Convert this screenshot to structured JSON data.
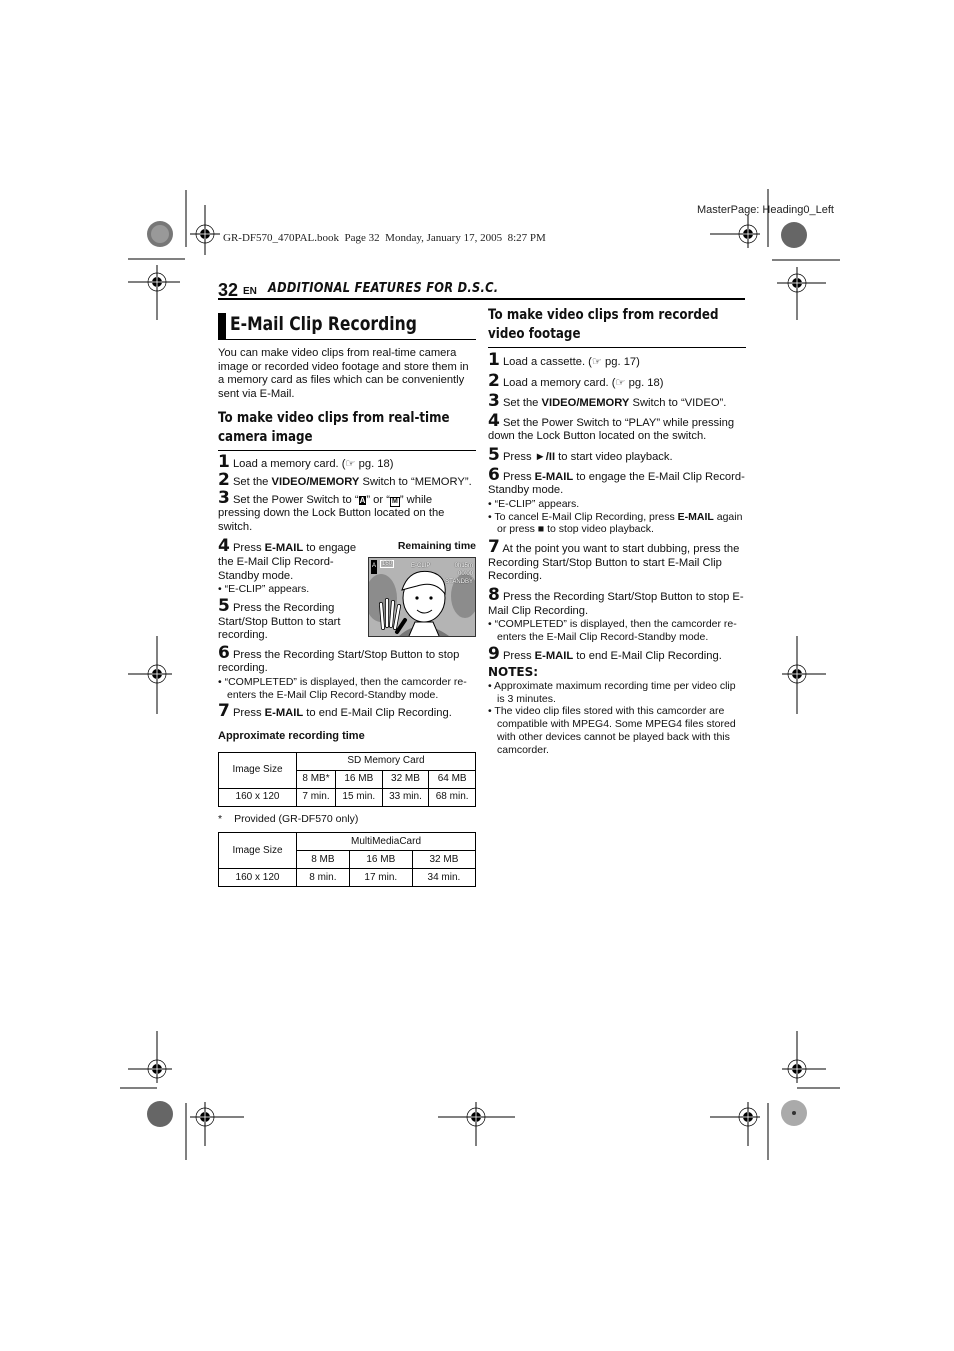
{
  "print_meta": {
    "book_line": "GR-DF570_470PAL.book  Page 32  Monday, January 17, 2005  8:27 PM",
    "master_page": "MasterPage: Heading0_Left"
  },
  "header": {
    "page_number": "32",
    "lang": "EN",
    "section": "ADDITIONAL FEATURES FOR D.S.C."
  },
  "left": {
    "title": "E-Mail Clip Recording",
    "intro": "You can make video clips from real-time camera image or recorded video footage and store them in a memory card as files which can be conveniently sent via E-Mail.",
    "subheading": "To make video clips from real-time camera image",
    "steps": [
      {
        "n": "1",
        "pre": "Load a memory card. (",
        "ref": "☞",
        "post": " pg. 18)"
      },
      {
        "n": "2",
        "pre": "Set the ",
        "bold": "VIDEO/MEMORY",
        "post": " Switch to “MEMORY”."
      },
      {
        "n": "3",
        "pre": "Set the Power Switch to “",
        "icon1": "A",
        "mid": "” or “",
        "icon2": "M",
        "post": "” while pressing down the Lock Button located on the switch."
      },
      {
        "n": "4",
        "pre": "Press ",
        "bold": "E-MAIL",
        "post": " to engage the E-Mail Clip Record-Standby mode."
      },
      {
        "n": "5",
        "pre": "Press the Recording Start/Stop Button to start recording."
      },
      {
        "n": "6",
        "pre": "Press the Recording Start/Stop Button to stop recording."
      },
      {
        "n": "7",
        "pre": "Press ",
        "bold": "E-MAIL",
        "post": " to end E-Mail Clip Recording."
      }
    ],
    "step4_bullet": "“E-CLIP” appears.",
    "step6_bullet": "“COMPLETED” is displayed, then the camcorder re-enters the E-Mail Clip Record-Standby mode.",
    "figure": {
      "label": "Remaining time",
      "osd_mode": "A",
      "osd_size": "160",
      "osd_eclip": "E-CLIP",
      "osd_remaining": "0h15m",
      "osd_counter": "00:00",
      "osd_status": "STANDBY"
    },
    "table_title": "Approximate recording time",
    "table1": {
      "row_header": "Image Size",
      "group": "SD Memory Card",
      "columns": [
        "8 MB*",
        "16 MB",
        "32 MB",
        "64 MB"
      ],
      "row_label": "160 x 120",
      "values": [
        "7 min.",
        "15 min.",
        "33 min.",
        "68 min."
      ]
    },
    "footnote_mark": "*",
    "footnote": "Provided (GR-DF570 only)",
    "table2": {
      "row_header": "Image Size",
      "group": "MultiMediaCard",
      "columns": [
        "8 MB",
        "16 MB",
        "32 MB"
      ],
      "row_label": "160 x 120",
      "values": [
        "8 min.",
        "17 min.",
        "34 min."
      ]
    }
  },
  "right": {
    "subheading": "To make video clips from recorded video footage",
    "steps": [
      {
        "n": "1",
        "pre": "Load a cassette. (",
        "ref": "☞",
        "post": " pg. 17)"
      },
      {
        "n": "2",
        "pre": "Load a memory card. (",
        "ref": "☞",
        "post": " pg. 18)"
      },
      {
        "n": "3",
        "pre": "Set the ",
        "bold": "VIDEO/MEMORY",
        "post": " Switch to “VIDEO”."
      },
      {
        "n": "4",
        "pre": "Set the Power Switch to “PLAY” while pressing down the Lock Button located on the switch."
      },
      {
        "n": "5",
        "pre": "Press ",
        "bold": "►/II",
        "post": " to start video playback."
      },
      {
        "n": "6",
        "pre": "Press ",
        "bold": "E-MAIL",
        "post": " to engage the E-Mail Clip Record-Standby mode."
      },
      {
        "n": "7",
        "pre": "At the point you want to start dubbing, press the Recording Start/Stop Button to start E-Mail Clip Recording."
      },
      {
        "n": "8",
        "pre": "Press the Recording Start/Stop Button to stop E-Mail Clip Recording."
      },
      {
        "n": "9",
        "pre": "Press ",
        "bold": "E-MAIL",
        "post": " to end E-Mail Clip Recording."
      }
    ],
    "step6_bullets": {
      "b1": "“E-CLIP” appears.",
      "b2_pre": "To cancel E-Mail Clip Recording, press ",
      "b2_bold": "E-MAIL",
      "b2_post": " again or press ■ to stop video playback."
    },
    "step8_bullet": "“COMPLETED” is displayed, then the camcorder re-enters the E-Mail Clip Record-Standby mode.",
    "notes_heading": "NOTES:",
    "notes": [
      "Approximate maximum recording time per video clip is 3 minutes.",
      "The video clip files stored with this camcorder are compatible with MPEG4. Some MPEG4 files stored with other devices cannot be played back with this camcorder."
    ]
  }
}
